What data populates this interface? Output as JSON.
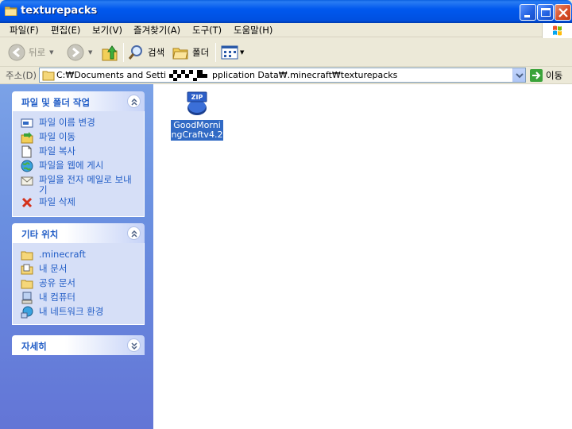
{
  "window": {
    "title": "texturepacks"
  },
  "menu": {
    "items": [
      "파일(F)",
      "편집(E)",
      "보기(V)",
      "즐겨찾기(A)",
      "도구(T)",
      "도움말(H)"
    ]
  },
  "toolbar": {
    "back_label": "뒤로",
    "search_label": "검색",
    "folders_label": "폴더"
  },
  "address": {
    "label": "주소(D)",
    "path": "C:\\Documents and Settings\\[redacted]\\Application Data\\.minecraft\\texturepacks",
    "path_visible_start": "C:₩Documents and Setting",
    "path_visible_end": "pplication Data₩.minecraft₩texturepacks",
    "go_label": "이동"
  },
  "tasks_panel": {
    "title": "파일 및 폴더 작업",
    "items": [
      {
        "label": "파일 이름 변경",
        "icon": "rename-icon"
      },
      {
        "label": "파일 이동",
        "icon": "move-icon"
      },
      {
        "label": "파일 복사",
        "icon": "copy-icon"
      },
      {
        "label": "파일을 웹에 게시",
        "icon": "publish-web-icon"
      },
      {
        "label": "파일을 전자 메일로 보내기",
        "icon": "email-icon"
      },
      {
        "label": "파일 삭제",
        "icon": "delete-icon"
      }
    ]
  },
  "places_panel": {
    "title": "기타 위치",
    "items": [
      {
        "label": ".minecraft",
        "icon": "folder-icon"
      },
      {
        "label": "내 문서",
        "icon": "my-documents-icon"
      },
      {
        "label": "공유 문서",
        "icon": "shared-folder-icon"
      },
      {
        "label": "내 컴퓨터",
        "icon": "my-computer-icon"
      },
      {
        "label": "내 네트워크 환경",
        "icon": "network-icon"
      }
    ]
  },
  "details_panel": {
    "title": "자세히"
  },
  "files": [
    {
      "name": "GoodMorningCraftv4.2",
      "type": "zip",
      "selected": true
    }
  ],
  "colors": {
    "titlebar": "#0058ee",
    "taskpane": "#6a8fe0",
    "link": "#215dc6",
    "selection": "#316ac5"
  }
}
